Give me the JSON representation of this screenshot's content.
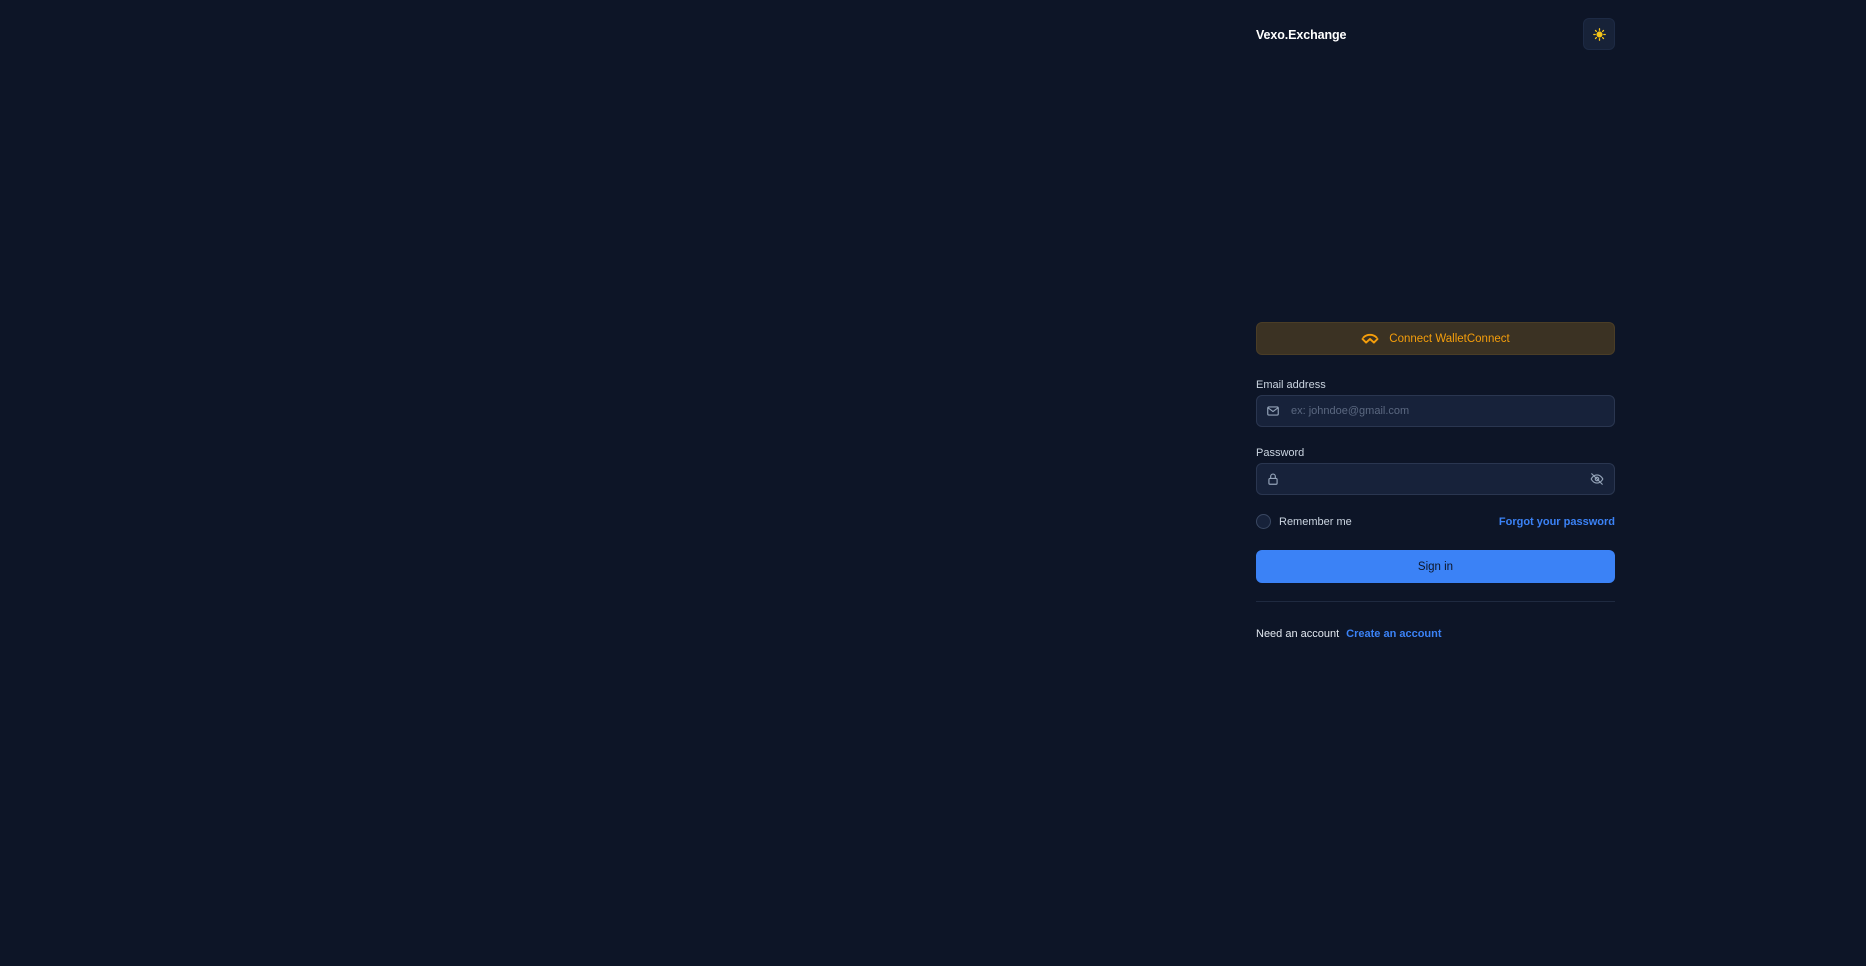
{
  "header": {
    "brand": "Vexo.Exchange",
    "theme_icon": "sun-icon"
  },
  "walletconnect": {
    "label": "Connect WalletConnect",
    "icon": "walletconnect-icon",
    "color": "#f59e0b"
  },
  "email": {
    "label": "Email address",
    "placeholder": "ex: johndoe@gmail.com",
    "value": "",
    "icon": "mail-icon"
  },
  "password": {
    "label": "Password",
    "placeholder": "",
    "value": "",
    "icon": "lock-icon",
    "toggle_icon": "eye-off-icon"
  },
  "remember": {
    "label": "Remember me",
    "checked": false
  },
  "forgot_label": "Forgot your password",
  "signin_label": "Sign in",
  "signup": {
    "prompt": "Need an account",
    "link": "Create an account"
  },
  "colors": {
    "background": "#0d1527",
    "accent": "#3b82f6",
    "wallet": "#f59e0b"
  }
}
